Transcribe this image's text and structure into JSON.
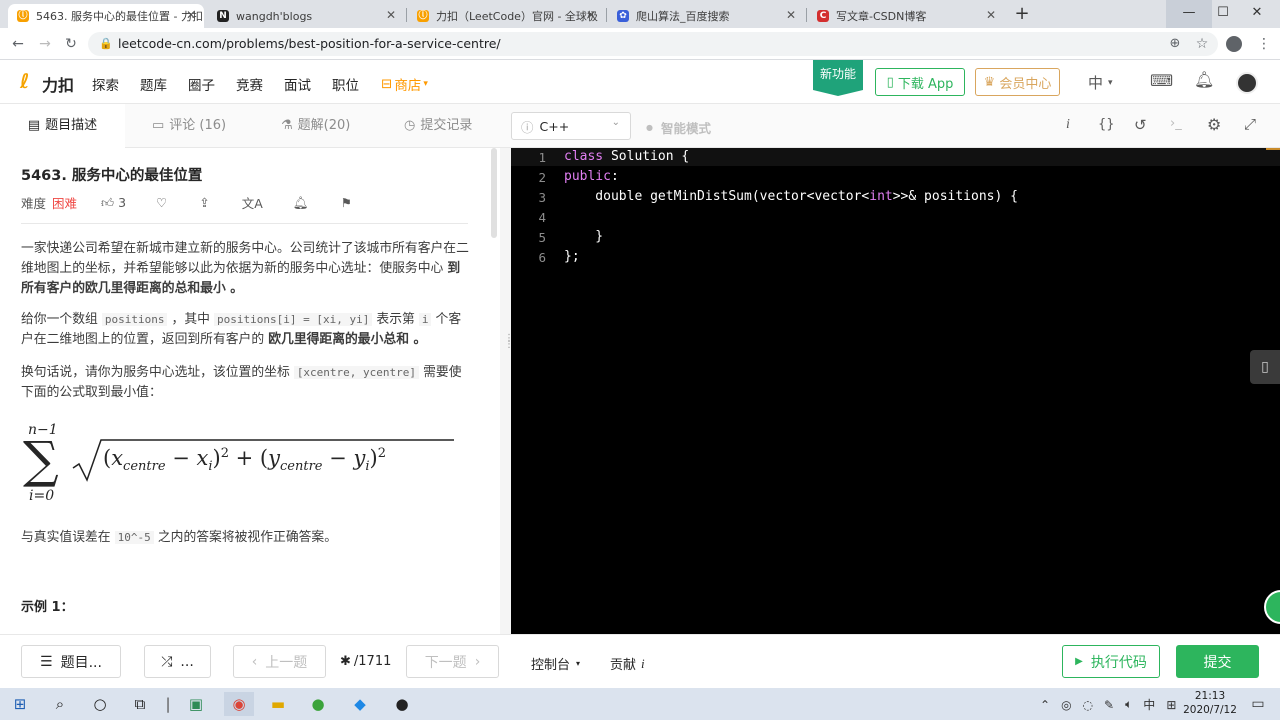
{
  "browser": {
    "tabs": [
      {
        "title": "5463. 服务中心的最佳位置 - 力扣",
        "icon": "leetcode-icon",
        "active": true
      },
      {
        "title": "wangdh'blogs",
        "icon": "notion-icon",
        "active": false
      },
      {
        "title": "力扣（LeetCode）官网 - 全球极",
        "icon": "leetcode-icon",
        "active": false
      },
      {
        "title": "爬山算法_百度搜索",
        "icon": "baidu-icon",
        "active": false
      },
      {
        "title": "写文章-CSDN博客",
        "icon": "csdn-icon",
        "active": false
      }
    ],
    "url": "leetcode-cn.com/problems/best-position-for-a-service-centre/"
  },
  "site_nav": {
    "logo": "力扣",
    "links": [
      "探索",
      "题库",
      "圈子",
      "竞赛",
      "面试",
      "职位"
    ],
    "store": "商店",
    "new_feature": "新功能",
    "download_app": "下载 App",
    "member": "会员中心",
    "lang": "中"
  },
  "panel_tabs": {
    "description": "题目描述",
    "comments": "评论 (16)",
    "solutions": "题解(20)",
    "submissions": "提交记录"
  },
  "editor_toolbar": {
    "language": "C++",
    "smart_mode": "智能模式",
    "info_icon": "i",
    "format_icon": "{}"
  },
  "problem": {
    "title": "5463. 服务中心的最佳位置",
    "difficulty_label": "难度",
    "difficulty": "困难",
    "likes": "3",
    "p1_a": "一家快递公司希望在新城市建立新的服务中心。公司统计了该城市所有客户在二维地图上的坐标，并希望能够以此为依据为新的服务中心选址：使服务中心 ",
    "p1_b": "到所有客户的欧几里得距离的总和最小",
    "p1_c": " 。",
    "p2_a": "给你一个数组 ",
    "p2_code1": "positions",
    "p2_b": " ，其中 ",
    "p2_code2": "positions[i] = [xi, yi]",
    "p2_c": " 表示第 ",
    "p2_code3": "i",
    "p2_d": " 个客户在二维地图上的位置，返回到所有客户的 ",
    "p2_bold": "欧几里得距离的最小总和",
    "p2_e": " 。",
    "p3_a": "换句话说，请你为服务中心选址，该位置的坐标 ",
    "p3_code": "[xcentre, ycentre]",
    "p3_b": " 需要使下面的公式取到最小值：",
    "formula_top": "n−1",
    "formula_bottom": "i=0",
    "p4_a": "与真实值误差在 ",
    "p4_code": "10^-5",
    "p4_b": " 之内的答案将被视作正确答案。",
    "example": "示例 1："
  },
  "code": {
    "line_numbers": [
      "1",
      "2",
      "3",
      "4",
      "5",
      "6"
    ],
    "l1_kw": "class",
    "l1_rest": " Solution {",
    "l2_kw": "public",
    "l2_rest": ":",
    "l3_a": "    double getMinDistSum(vector<vector<",
    "l3_kw": "int",
    "l3_b": ">>& positions) {",
    "l5": "    }",
    "l6": "};"
  },
  "footer": {
    "problems": "题目...",
    "random": "...",
    "prev": "上一题",
    "counter": "/1711",
    "next": "下一题",
    "console": "控制台",
    "contribute": "贡献",
    "run": "执行代码",
    "submit": "提交"
  },
  "taskbar": {
    "time": "21:13",
    "date": "2020/7/12",
    "ime": "中"
  },
  "colors": {
    "accent_green": "#2db55d",
    "difficulty_red": "#ef4743",
    "store_orange": "#ff9900",
    "keyword_purple": "#e17ff2"
  }
}
